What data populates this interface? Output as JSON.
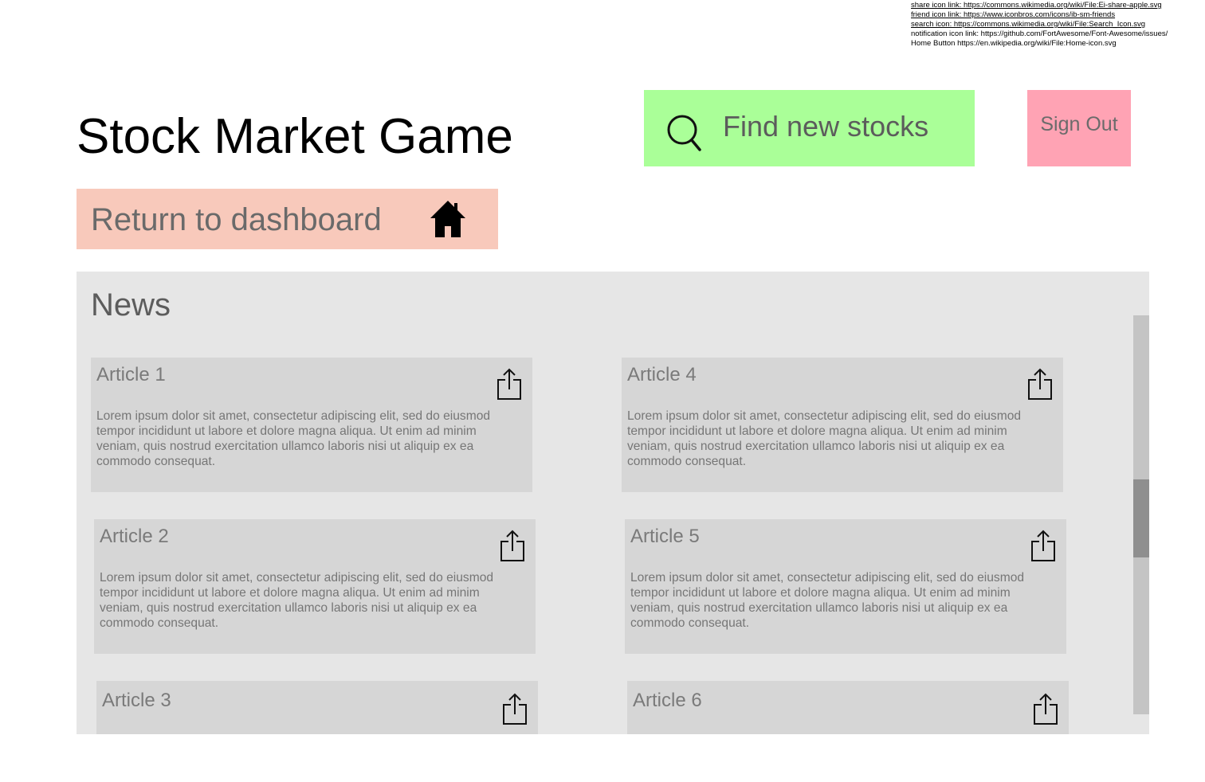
{
  "credits": [
    "share icon link: https://commons.wikimedia.org/wiki/File:Ei-share-apple.svg",
    "friend icon link: https://www.iconbros.com/icons/ib-sm-friends",
    "search icon: https://commons.wikimedia.org/wiki/File:Search_Icon.svg",
    "notification icon link: https://github.com/FortAwesome/Font-Awesome/issues/",
    "Home Button https://en.wikipedia.org/wiki/File:Home-icon.svg"
  ],
  "header": {
    "title": "Stock Market Game",
    "search_label": "Find new stocks",
    "signout_label": "Sign Out",
    "return_label": "Return to dashboard"
  },
  "colors": {
    "search_bg": "#aaff98",
    "signout_bg": "#ffa3b4",
    "return_bg": "#f8c9bb",
    "panel_bg": "#e6e6e6",
    "card_bg": "#d6d6d6"
  },
  "icons": {
    "search": "search-icon",
    "home": "home-icon",
    "share": "share-icon"
  },
  "news": {
    "title": "News",
    "articles": [
      {
        "title": "Article 1",
        "body": "Lorem ipsum dolor sit amet, consectetur adipiscing elit, sed do eiusmod tempor incididunt ut labore et dolore magna aliqua. Ut enim ad minim veniam, quis nostrud exercitation ullamco laboris nisi ut aliquip ex ea commodo consequat."
      },
      {
        "title": "Article 2",
        "body": "Lorem ipsum dolor sit amet, consectetur adipiscing elit, sed do eiusmod tempor incididunt ut labore et dolore magna aliqua. Ut enim ad minim veniam, quis nostrud exercitation ullamco laboris nisi ut aliquip ex ea commodo consequat."
      },
      {
        "title": "Article 3",
        "body": ""
      },
      {
        "title": "Article 4",
        "body": "Lorem ipsum dolor sit amet, consectetur adipiscing elit, sed do eiusmod tempor incididunt ut labore et dolore magna aliqua. Ut enim ad minim veniam, quis nostrud exercitation ullamco laboris nisi ut aliquip ex ea commodo consequat."
      },
      {
        "title": "Article 5",
        "body": "Lorem ipsum dolor sit amet, consectetur adipiscing elit, sed do eiusmod tempor incididunt ut labore et dolore magna aliqua. Ut enim ad minim veniam, quis nostrud exercitation ullamco laboris nisi ut aliquip ex ea commodo consequat."
      },
      {
        "title": "Article 6",
        "body": ""
      }
    ]
  }
}
